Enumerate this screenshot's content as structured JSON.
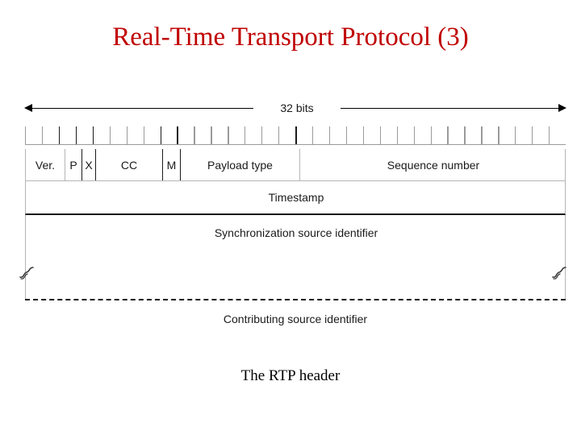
{
  "slide": {
    "title": "Real-Time Transport Protocol (3)",
    "title_color": "#C00000",
    "caption": "The RTP header",
    "background": "#FFFFFF"
  },
  "figure": {
    "width_label": "32 bits",
    "bit_count": 32,
    "rows": [
      {
        "name": "first-word",
        "fields": [
          {
            "label": "Ver.",
            "bits": 2
          },
          {
            "label": "P",
            "bits": 1
          },
          {
            "label": "X",
            "bits": 1
          },
          {
            "label": "CC",
            "bits": 4
          },
          {
            "label": "M",
            "bits": 1
          },
          {
            "label": "Payload type",
            "bits": 7
          },
          {
            "label": "Sequence number",
            "bits": 16
          }
        ]
      },
      {
        "name": "second-word",
        "fields": [
          {
            "label": "Timestamp",
            "bits": 32
          }
        ]
      },
      {
        "name": "third-word",
        "fields": [
          {
            "label": "Synchronization source identifier",
            "bits": 32
          }
        ]
      },
      {
        "name": "fourth-word",
        "fields": [
          {
            "label": "Contributing source identifier",
            "bits": 32
          }
        ]
      }
    ],
    "break_marks": {
      "left": "squiggle-break",
      "right": "squiggle-break"
    },
    "separator_style": "dashed",
    "line_color": "#1A1A1A",
    "border_color": "#B5B5B5"
  }
}
